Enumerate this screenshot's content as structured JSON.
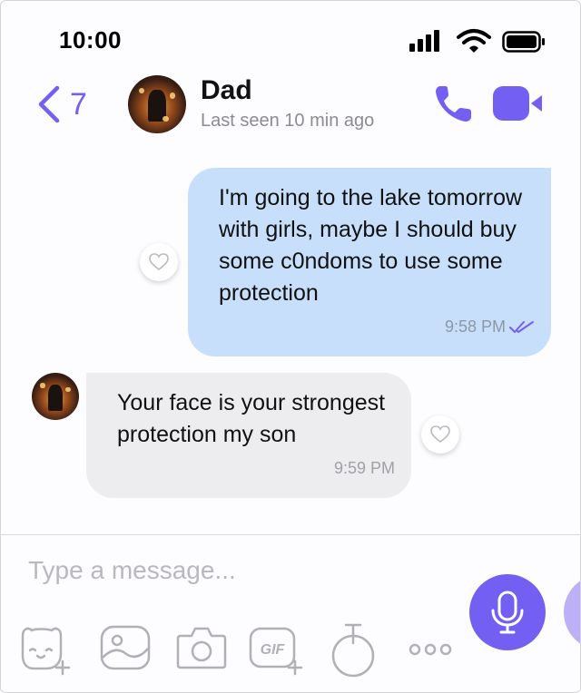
{
  "status_bar": {
    "time": "10:00"
  },
  "header": {
    "back_count": "7",
    "contact_name": "Dad",
    "contact_status": "Last seen 10 min ago"
  },
  "messages": [
    {
      "direction": "outgoing",
      "text": "I'm going to the lake tomorrow with girls, maybe I should buy some c0ndoms to use some protection",
      "time": "9:58 PM"
    },
    {
      "direction": "incoming",
      "text": "Your face is your strongest protection my son",
      "time": "9:59 PM"
    }
  ],
  "composer": {
    "placeholder": "Type a message..."
  },
  "icons": [
    "back-chevron-icon",
    "phone-icon",
    "video-icon",
    "heart-icon",
    "double-check-icon",
    "sticker-icon",
    "gallery-icon",
    "camera-icon",
    "gif-icon",
    "timer-icon",
    "more-icon",
    "microphone-icon"
  ],
  "colors": {
    "accent": "#7360f2",
    "outgoing_bubble": "#c7dffb",
    "incoming_bubble": "#ededf0"
  }
}
